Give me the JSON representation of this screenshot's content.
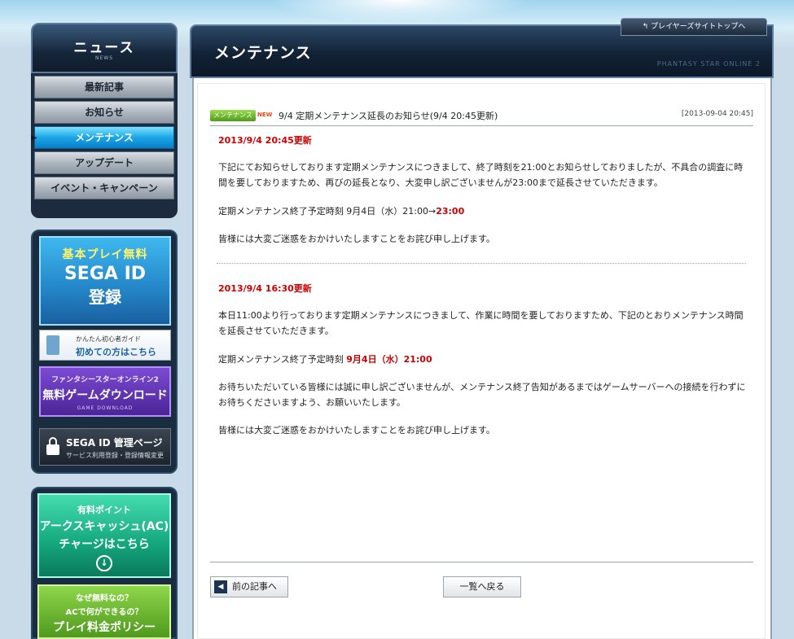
{
  "header": {
    "top_link": "プレイヤーズサイトトップへ",
    "page_title": "メンテナンス",
    "page_subtitle": "PHANTASY STAR ONLINE 2"
  },
  "sidebar": {
    "news_title": "ニュース",
    "news_sub": "NEWS",
    "items": [
      {
        "label": "最新記事"
      },
      {
        "label": "お知らせ"
      },
      {
        "label": "メンテナンス"
      },
      {
        "label": "アップデート"
      },
      {
        "label": "イベント・キャンペーン"
      }
    ],
    "active_index": 2
  },
  "banners": {
    "free_play": {
      "line1": "基本プレイ無料",
      "line2": "SEGA ID",
      "line3": "登録"
    },
    "guide": {
      "small": "かんたん初心者ガイド",
      "big": "初めての方はこちら"
    },
    "download": {
      "line1": "ファンタシースターオンライン2",
      "line2": "無料ゲームダウンロード",
      "line3": "GAME DOWNLOAD"
    },
    "sega_id": {
      "line1": "SEGA ID 管理ページ",
      "line2": "サービス利用登録・登録情報変更"
    },
    "ac_charge": {
      "line1": "有料ポイント",
      "line2": "アークスキャッシュ(AC)",
      "line3": "チャージはこちら"
    },
    "policy": {
      "line1": "なぜ無料なの？",
      "line2": "ACで何ができるの？",
      "line3": "プレイ料金ポリシー"
    }
  },
  "post": {
    "tag": "メンテナンス",
    "new_label": "NEW",
    "title": "9/4 定期メンテナンス延長のお知らせ(9/4 20:45更新)",
    "date": "[2013-09-04 20:45]"
  },
  "update1": {
    "heading": "2013/9/4 20:45更新",
    "para1": "下記にてお知らせしております定期メンテナンスにつきまして、終了時刻を21:00とお知らせしておりましたが、不具合の調査に時間を要しておりますため、再びの延長となり、大変申し訳ございませんが23:00まで延長させていただきます。",
    "schedule_prefix": "定期メンテナンス終了予定時刻 9月4日（水）21:00→",
    "schedule_new": "23:00",
    "apology": "皆様には大変ご迷惑をおかけいたしますことをお詫び申し上げます。"
  },
  "update2": {
    "heading": "2013/9/4 16:30更新",
    "para1": "本日11:00より行っております定期メンテナンスにつきまして、作業に時間を要しておりますため、下記のとおりメンテナンス時間を延長させていただきます。",
    "schedule_prefix": "定期メンテナンス終了予定時刻 ",
    "schedule_time": "9月4日（水）21:00",
    "para2": "お待ちいただいている皆様には誠に申し訳ございませんが、メンテナンス終了告知があるまではゲームサーバーへの接続を行わずにお待ちくださいますよう、お願いいたします。",
    "apology": "皆様には大変ご迷惑をおかけいたしますことをお詫び申し上げます。"
  },
  "nav": {
    "prev_label": "前の記事へ",
    "list_label": "一覧へ戻る"
  },
  "colors": {
    "accent_red": "#cc0000",
    "menu_active": "#1aa6e6",
    "panel_dark": "#122236"
  }
}
